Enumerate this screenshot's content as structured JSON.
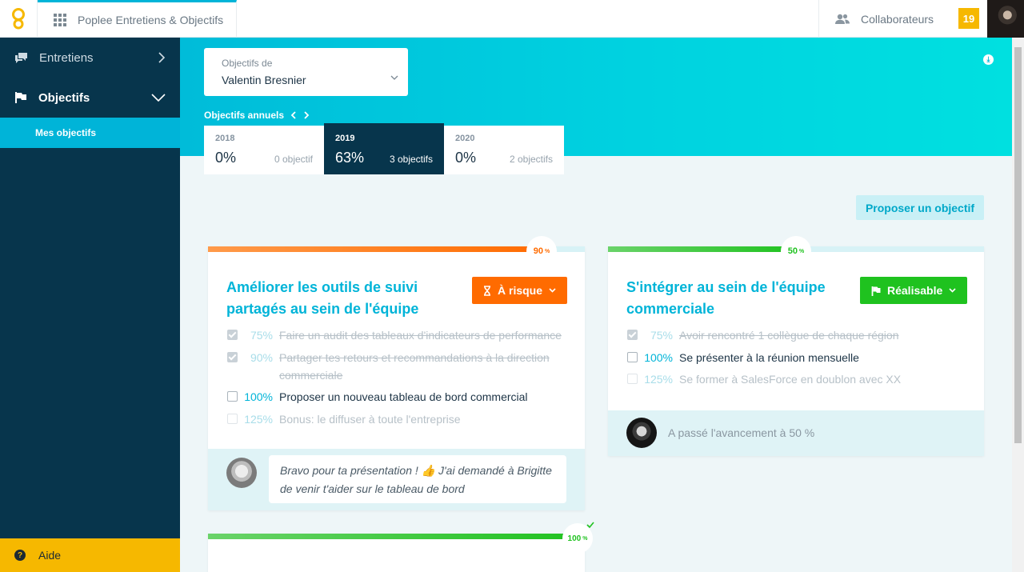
{
  "header": {
    "app_title": "Poplee Entretiens & Objectifs",
    "collaborators_label": "Collaborateurs",
    "notification_count": "19"
  },
  "sidebar": {
    "items": [
      {
        "label": "Entretiens",
        "icon": "chat-icon"
      },
      {
        "label": "Objectifs",
        "icon": "flag-icon"
      }
    ],
    "sub_item": "Mes objectifs",
    "help_label": "Aide"
  },
  "main": {
    "owner_select": {
      "label": "Objectifs de",
      "value": "Valentin Bresnier"
    },
    "annual_label": "Objectifs annuels",
    "years": [
      {
        "year": "2018",
        "pct": "0%",
        "count": "0 objectif"
      },
      {
        "year": "2019",
        "pct": "63%",
        "count": "3 objectifs",
        "selected": true
      },
      {
        "year": "2020",
        "pct": "0%",
        "count": "2 objectifs"
      }
    ],
    "propose_button": "Proposer un objectif",
    "cards": [
      {
        "progress": 90,
        "progress_label": "90",
        "title_line1": "Améliorer les outils de suivi",
        "title_line2": "partagés au sein de l'équipe",
        "status": "À risque",
        "status_color": "#ff6b00",
        "results": [
          {
            "pct": "75%",
            "text": "Faire un audit des tableaux d'indicateurs de performance",
            "state": "done"
          },
          {
            "pct": "90%",
            "text": "Partager tes retours et recommandations à la direction",
            "text2": "commerciale",
            "state": "done"
          },
          {
            "pct": "100%",
            "text": "Proposer un nouveau tableau de bord commercial",
            "state": "open"
          },
          {
            "pct": "125%",
            "text": "Bonus: le diffuser à toute l'entreprise",
            "state": "light"
          }
        ],
        "comment_line1": "Bravo pour ta présentation ! 👍 J'ai demandé à Brigitte",
        "comment_line2": "de venir t'aider sur le tableau de bord"
      },
      {
        "progress": 50,
        "progress_label": "50",
        "title_line1": "S'intégrer au sein de l'équipe",
        "title_line2": "commerciale",
        "status": "Réalisable",
        "status_color": "#1fc21f",
        "results": [
          {
            "pct": "75%",
            "text": "Avoir rencontré 1 collègue de chaque région",
            "state": "done"
          },
          {
            "pct": "100%",
            "text": "Se présenter à la réunion mensuelle",
            "state": "open"
          },
          {
            "pct": "125%",
            "text": "Se former à SalesForce en doublon avec XX",
            "state": "light"
          }
        ],
        "activity": "A passé l'avancement à 50 %"
      },
      {
        "progress": 100,
        "progress_label": "100"
      }
    ]
  },
  "colors": {
    "accent": "#00b4d8",
    "sidebar": "#07354c",
    "warning": "#ff6b00",
    "success": "#1fc21f",
    "help": "#f6b800"
  }
}
